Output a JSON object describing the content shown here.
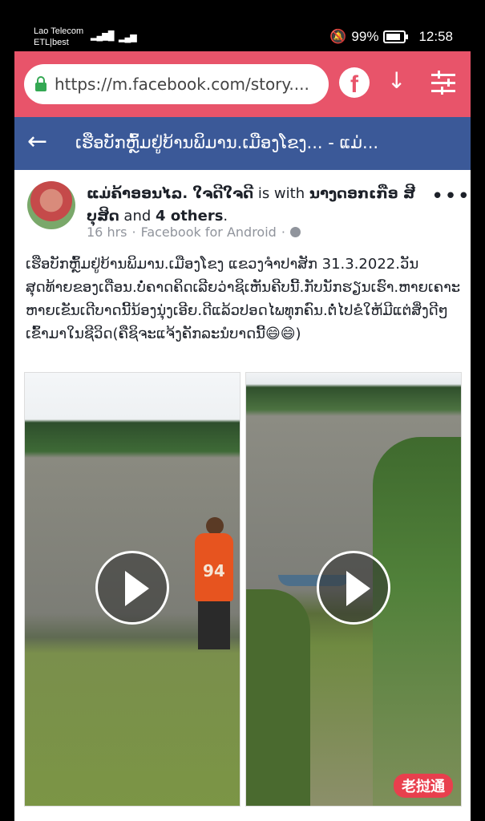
{
  "status_bar": {
    "carrier1": "Lao Telecom",
    "carrier2": "ETL|best",
    "network": "4G",
    "battery": "99%",
    "time": "12:58"
  },
  "browser": {
    "url": "https://m.facebook.com/story....",
    "fb_icon": "f"
  },
  "page_header": {
    "title": "ເຮືອບັກຫຼົ້ມຢູ່ບ້ານພິມານ.ເມືອງໂຂງ... - ແມ່..."
  },
  "post": {
    "author": "ແມ່ຄ້າອອນໄລ. ໃຈດີໃຈດີ",
    "with_text": "is with",
    "tagged": "ນາງດອກເກືອ ສີບຸສິດ",
    "and_text": "and",
    "others": "4 others",
    "time": "16 hrs",
    "source": "Facebook for Android",
    "separator": "·",
    "more": "•••",
    "text": "ເຮືອບັກຫຼົ້ມຢູ່ບ້ານພິມານ.ເມືອງໂຂງ ແຂວງຈຳປາສັກ 31.3.2022.ວັນສຸດທ້າຍຂອງເດືອນ.ບໍ່ຄາດຄິດເລີຍວ່າຊິເຫັນຄີບນີ້.ກັບນັກຮຽນເຮົາ.ຫາຍເຄາະຫາຍເຂັນເດີບາດນີ້ນ້ອງນຸ່ງເອີຍ.ດີແລ້ວປອດໄພທຸກຄົນ.ຕໍ່ໄປຂໍໃຫ້ມີແຕ່ສິ່ງດີໆເຂົ້າມາໃນຊີວິດ(ຄືຊິຈະແຈ້ງຄັກລະນໍບາດນີ້😄😄)"
  },
  "video1": {
    "jersey": "94"
  },
  "watermark": "老挝通"
}
